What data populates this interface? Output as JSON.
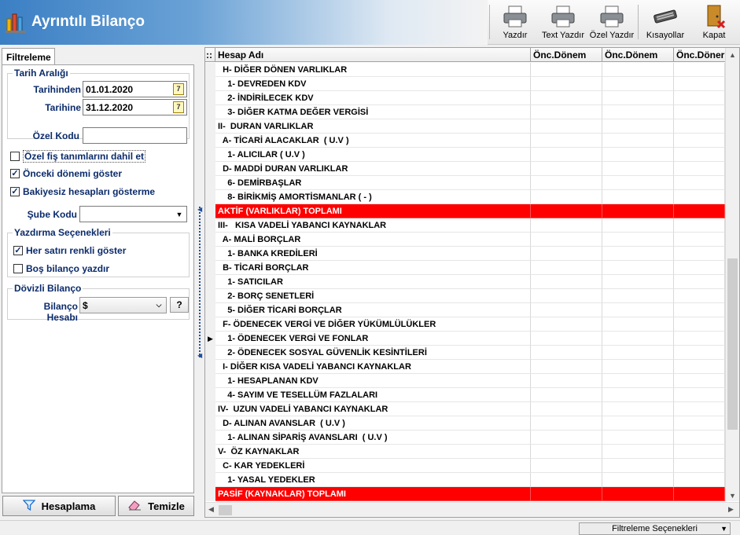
{
  "header": {
    "title": "Ayrıntılı Bilanço"
  },
  "toolbar": {
    "buttons": [
      {
        "label": "Yazdır",
        "icon": "printer-icon"
      },
      {
        "label": "Text Yazdır",
        "icon": "printer-icon"
      },
      {
        "label": "Özel Yazdır",
        "icon": "printer-icon"
      },
      {
        "label": "Kısayollar",
        "icon": "keyboard-icon"
      },
      {
        "label": "Kapat",
        "icon": "close-door-icon"
      }
    ]
  },
  "left_panel": {
    "tab": "Filtreleme",
    "date_group": "Tarih Aralığı",
    "from_label": "Tarihinden",
    "from_value": "01.01.2020",
    "to_label": "Tarihine",
    "to_value": "31.12.2020",
    "special_code_label": "Özel Kodu",
    "special_code_value": "",
    "checks": [
      {
        "label": "Özel fiş tanımlarını dahil et",
        "checked": false
      },
      {
        "label": "Önceki dönemi göster",
        "checked": true
      },
      {
        "label": "Bakiyesiz hesapları gösterme",
        "checked": true
      }
    ],
    "branch_label": "Şube Kodu",
    "branch_value": "",
    "print_group": "Yazdırma Seçenekleri",
    "print_checks": [
      {
        "label": "Her satırı renkli göster",
        "checked": true
      },
      {
        "label": "Boş bilanço yazdır",
        "checked": false
      }
    ],
    "fx_group": "Dövizli Bilanço",
    "fx_label": "Bilanço Hesabı",
    "fx_value": "$",
    "fx_help": "?",
    "calc_button": "Hesaplama",
    "clear_button": "Temizle"
  },
  "grid": {
    "headers": [
      "Hesap Adı",
      "Önc.Dönem",
      "Önc.Dönem",
      "Önc.Döner"
    ],
    "rows": [
      {
        "text": "  H- DİĞER DÖNEN VARLIKLAR",
        "red": false
      },
      {
        "text": "    1- DEVREDEN KDV",
        "red": false
      },
      {
        "text": "    2- İNDİRİLECEK KDV",
        "red": false
      },
      {
        "text": "    3- DİĞER KATMA DEĞER VERGİSİ",
        "red": false
      },
      {
        "text": "II-  DURAN VARLIKLAR",
        "red": false
      },
      {
        "text": "  A- TİCARİ ALACAKLAR  ( U.V )",
        "red": false
      },
      {
        "text": "    1- ALICILAR ( U.V )",
        "red": false
      },
      {
        "text": "  D- MADDİ DURAN VARLIKLAR",
        "red": false
      },
      {
        "text": "    6- DEMİRBAŞLAR",
        "red": false
      },
      {
        "text": "    8- BİRİKMİŞ AMORTİSMANLAR ( - )",
        "red": false
      },
      {
        "text": "AKTİF (VARLIKLAR) TOPLAMI",
        "red": true
      },
      {
        "text": "III-   KISA VADELİ YABANCI KAYNAKLAR",
        "red": false
      },
      {
        "text": "  A- MALİ BORÇLAR",
        "red": false
      },
      {
        "text": "    1- BANKA KREDİLERİ",
        "red": false
      },
      {
        "text": "  B- TİCARİ BORÇLAR",
        "red": false
      },
      {
        "text": "    1- SATICILAR",
        "red": false
      },
      {
        "text": "    2- BORÇ SENETLERİ",
        "red": false
      },
      {
        "text": "    5- DİĞER TİCARİ BORÇLAR",
        "red": false
      },
      {
        "text": "  F- ÖDENECEK VERGİ VE DİĞER YÜKÜMLÜLÜKLER",
        "red": false
      },
      {
        "text": "    1- ÖDENECEK VERGİ VE FONLAR",
        "red": false,
        "current": true
      },
      {
        "text": "    2- ÖDENECEK SOSYAL GÜVENLİK KESİNTİLERİ",
        "red": false
      },
      {
        "text": "  I- DİĞER KISA VADELİ YABANCI KAYNAKLAR",
        "red": false
      },
      {
        "text": "    1- HESAPLANAN KDV",
        "red": false
      },
      {
        "text": "    4- SAYIM VE TESELLÜM FAZLALARI",
        "red": false
      },
      {
        "text": "IV-  UZUN VADELİ YABANCI KAYNAKLAR",
        "red": false
      },
      {
        "text": "  D- ALINAN AVANSLAR  ( U.V )",
        "red": false
      },
      {
        "text": "    1- ALINAN SİPARİŞ AVANSLARI  ( U.V )",
        "red": false
      },
      {
        "text": "V-  ÖZ KAYNAKLAR",
        "red": false
      },
      {
        "text": "  C- KAR YEDEKLERİ",
        "red": false
      },
      {
        "text": "    1- YASAL YEDEKLER",
        "red": false
      },
      {
        "text": "PASİF (KAYNAKLAR) TOPLAMI",
        "red": true
      }
    ]
  },
  "status": {
    "filter_label": "Filtreleme Seçenekleri"
  }
}
